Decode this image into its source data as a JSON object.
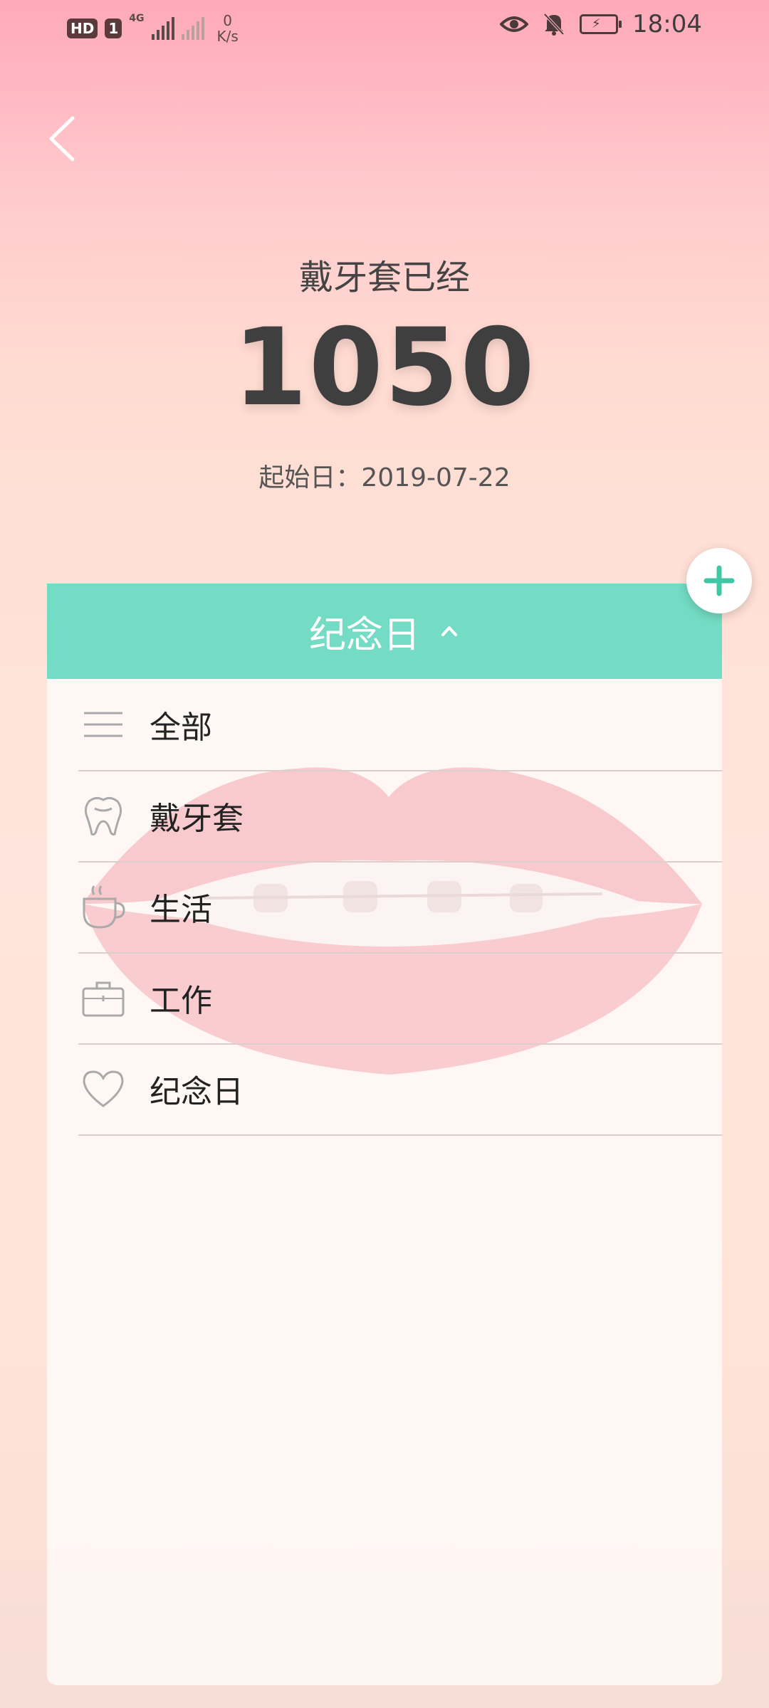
{
  "status_bar": {
    "hd": "HD",
    "sim": "1",
    "network": "4G",
    "speed_value": "0",
    "speed_unit": "K/s",
    "time": "18:04"
  },
  "hero": {
    "title": "戴牙套已经",
    "count": "1050",
    "start_label": "起始日：2019-07-22"
  },
  "panel": {
    "header_label": "纪念日",
    "items": [
      {
        "label": "全部",
        "icon": "menu-lines-icon"
      },
      {
        "label": "戴牙套",
        "icon": "tooth-icon"
      },
      {
        "label": "生活",
        "icon": "coffee-cup-icon"
      },
      {
        "label": "工作",
        "icon": "briefcase-icon"
      },
      {
        "label": "纪念日",
        "icon": "heart-icon"
      }
    ]
  },
  "colors": {
    "accent": "#74dcc4",
    "fab_plus": "#3ec8a4"
  }
}
